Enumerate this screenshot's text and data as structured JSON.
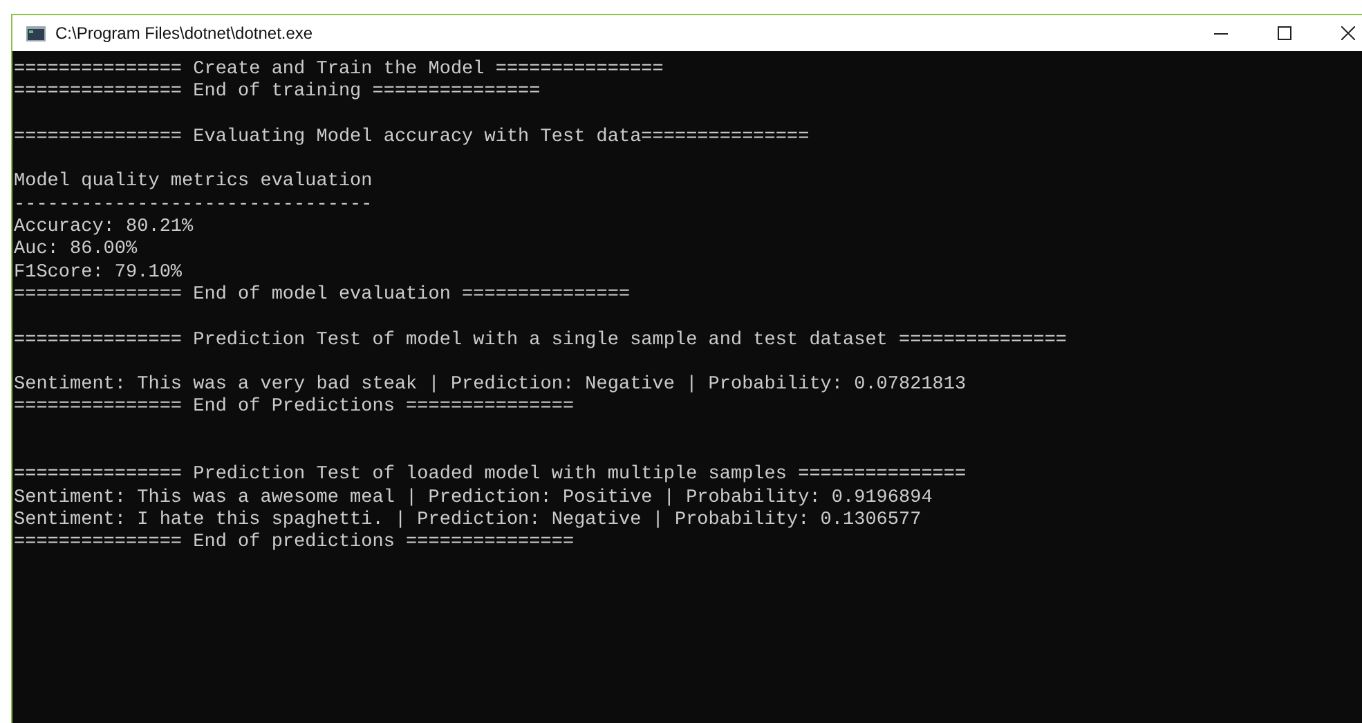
{
  "window": {
    "title": "C:\\Program Files\\dotnet\\dotnet.exe"
  },
  "console": {
    "lines": [
      {
        "kind": "text",
        "text": "=============== Create and Train the Model ==============="
      },
      {
        "kind": "text",
        "text": "=============== End of training ==============="
      },
      {
        "kind": "blank"
      },
      {
        "kind": "text",
        "text": "=============== Evaluating Model accuracy with Test data==============="
      },
      {
        "kind": "blank"
      },
      {
        "kind": "text",
        "text": "Model quality metrics evaluation"
      },
      {
        "kind": "text",
        "text": "--------------------------------"
      },
      {
        "kind": "text",
        "text": "Accuracy: 80.21%"
      },
      {
        "kind": "text",
        "text": "Auc: 86.00%"
      },
      {
        "kind": "text",
        "text": "F1Score: 79.10%"
      },
      {
        "kind": "text",
        "text": "=============== End of model evaluation ==============="
      },
      {
        "kind": "blank"
      },
      {
        "kind": "text",
        "text": "=============== Prediction Test of model with a single sample and test dataset ==============="
      },
      {
        "kind": "blank"
      },
      {
        "kind": "text",
        "text": "Sentiment: This was a very bad steak | Prediction: Negative | Probability: 0.07821813"
      },
      {
        "kind": "text",
        "text": "=============== End of Predictions ==============="
      },
      {
        "kind": "blank"
      },
      {
        "kind": "blank"
      },
      {
        "kind": "text",
        "text": "=============== Prediction Test of loaded model with multiple samples ==============="
      },
      {
        "kind": "text",
        "text": "Sentiment: This was a awesome meal | Prediction: Positive | Probability: 0.9196894"
      },
      {
        "kind": "text",
        "text": "Sentiment: I hate this spaghetti. | Prediction: Negative | Probability: 0.1306577"
      },
      {
        "kind": "text",
        "text": "=============== End of predictions ==============="
      }
    ]
  }
}
